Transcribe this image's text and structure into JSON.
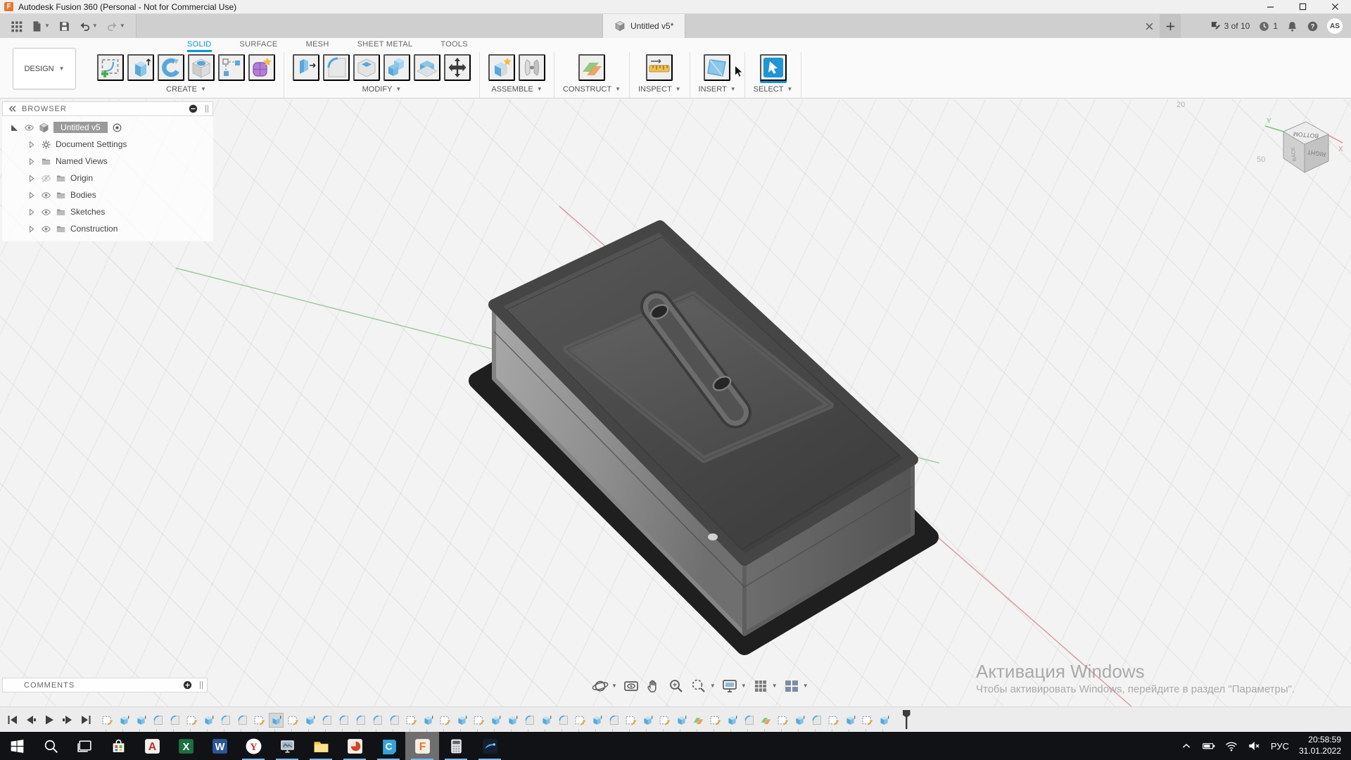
{
  "window": {
    "title": "Autodesk Fusion 360 (Personal - Not for Commercial Use)",
    "controls": [
      {
        "name": "minimize-button",
        "icon": "win-min"
      },
      {
        "name": "maximize-button",
        "icon": "win-max"
      },
      {
        "name": "close-button",
        "icon": "win-close"
      }
    ]
  },
  "quick_access": {
    "buttons": [
      {
        "name": "app-launcher-button",
        "icon": "grid9",
        "caret": false
      },
      {
        "name": "file-menu-button",
        "icon": "file",
        "caret": true
      },
      {
        "name": "save-button",
        "icon": "save",
        "caret": false
      },
      {
        "name": "undo-button",
        "icon": "undo",
        "caret": true
      },
      {
        "name": "redo-button",
        "icon": "redo",
        "caret": true
      }
    ]
  },
  "document_tab": {
    "label": "Untitled v5*"
  },
  "top_right": {
    "extensions_label": "3 of 10",
    "job_count": "1",
    "avatar": "AS"
  },
  "toolbar": {
    "design_label": "DESIGN",
    "tabs": [
      {
        "label": "SOLID",
        "active": true
      },
      {
        "label": "SURFACE",
        "active": false
      },
      {
        "label": "MESH",
        "active": false
      },
      {
        "label": "SHEET METAL",
        "active": false
      },
      {
        "label": "TOOLS",
        "active": false
      }
    ],
    "groups": [
      {
        "label": "CREATE",
        "icons": [
          "create-sketch",
          "extrude",
          "revolve",
          "hole",
          "pattern",
          "create-form"
        ]
      },
      {
        "label": "MODIFY",
        "icons": [
          "press-pull",
          "fillet-tool",
          "shell",
          "combine",
          "split-body",
          "move"
        ]
      },
      {
        "label": "ASSEMBLE",
        "icons": [
          "new-component",
          "joint"
        ]
      },
      {
        "label": "CONSTRUCT",
        "icons": [
          "construct-plane"
        ]
      },
      {
        "label": "INSPECT",
        "icons": [
          "measure"
        ]
      },
      {
        "label": "INSERT",
        "icons": [
          "insert-canvas"
        ]
      },
      {
        "label": "SELECT",
        "icons": [
          "select"
        ]
      }
    ],
    "active_tool": "select"
  },
  "browser": {
    "title": "BROWSER",
    "root": {
      "label": "Untitled v5"
    },
    "items": [
      {
        "label": "Document Settings",
        "icon": "gear",
        "eye": "none"
      },
      {
        "label": "Named Views",
        "icon": "folder",
        "eye": "none"
      },
      {
        "label": "Origin",
        "icon": "folder",
        "eye": "hidden"
      },
      {
        "label": "Bodies",
        "icon": "folder",
        "eye": "visible"
      },
      {
        "label": "Sketches",
        "icon": "folder",
        "eye": "visible"
      },
      {
        "label": "Construction",
        "icon": "folder",
        "eye": "visible"
      }
    ]
  },
  "comments": {
    "title": "COMMENTS"
  },
  "viewport": {
    "grid_labels": [
      "20",
      "50"
    ]
  },
  "viewcube": {
    "face_top": "BOTTOM",
    "face_front": "RIGHT",
    "face_left": "BACK",
    "axis_x": "X",
    "axis_y": "Y"
  },
  "navbar": {
    "buttons": [
      {
        "name": "orbit-button",
        "icon": "orbit",
        "caret": true
      },
      {
        "name": "look-at-button",
        "icon": "look-at",
        "caret": false
      },
      {
        "name": "pan-button",
        "icon": "pan",
        "caret": false
      },
      {
        "name": "zoom-button",
        "icon": "zoom",
        "caret": false
      },
      {
        "name": "fit-button",
        "icon": "fit",
        "caret": true
      },
      {
        "name": "display-settings-button",
        "icon": "display",
        "caret": true
      },
      {
        "name": "grid-settings-button",
        "icon": "grid-set",
        "caret": true
      },
      {
        "name": "viewports-button",
        "icon": "viewports",
        "caret": true
      }
    ]
  },
  "timeline": {
    "controls": [
      {
        "name": "go-to-start-button",
        "icon": "skip-start"
      },
      {
        "name": "step-back-button",
        "icon": "step-back"
      },
      {
        "name": "play-button",
        "icon": "play"
      },
      {
        "name": "step-forward-button",
        "icon": "step-fwd"
      },
      {
        "name": "go-to-end-button",
        "icon": "skip-end"
      }
    ],
    "features": [
      "sketch",
      "extrude",
      "extrude",
      "fillet",
      "fillet",
      "sketch",
      "extrude",
      "fillet",
      "fillet",
      "sketch",
      "extrude",
      "sketch",
      "extrude",
      "fillet",
      "fillet",
      "fillet",
      "fillet",
      "fillet",
      "sketch",
      "extrude",
      "sketch",
      "extrude",
      "sketch",
      "extrude",
      "extrude",
      "fillet",
      "extrude",
      "fillet",
      "sketch",
      "extrude",
      "fillet",
      "sketch",
      "extrude",
      "sketch",
      "extrude",
      "plane",
      "sketch",
      "extrude",
      "fillet",
      "plane",
      "sketch",
      "extrude",
      "fillet",
      "sketch",
      "extrude",
      "sketch",
      "extrude"
    ],
    "selected_index": 10
  },
  "watermark": {
    "line1": "Активация Windows",
    "line2": "Чтобы активировать Windows, перейдите в раздел \"Параметры\"."
  },
  "taskbar": {
    "apps": [
      {
        "name": "start-button",
        "icon": "start",
        "running": false,
        "active": false
      },
      {
        "name": "search-button",
        "icon": "search",
        "running": false,
        "active": false
      },
      {
        "name": "task-view-button",
        "icon": "task-view",
        "running": false,
        "active": false
      },
      {
        "name": "microsoft-store",
        "icon": "store",
        "running": false,
        "active": false
      },
      {
        "name": "autocad",
        "icon": "autocad",
        "running": false,
        "active": false
      },
      {
        "name": "excel",
        "icon": "excel",
        "running": false,
        "active": false
      },
      {
        "name": "word",
        "icon": "word",
        "running": false,
        "active": false
      },
      {
        "name": "yandex-browser",
        "icon": "yandex",
        "running": true,
        "active": false
      },
      {
        "name": "screen-capture-app",
        "icon": "snip",
        "running": true,
        "active": false
      },
      {
        "name": "file-explorer",
        "icon": "explorer",
        "running": true,
        "active": false
      },
      {
        "name": "powerpoint",
        "icon": "powerpoint",
        "running": true,
        "active": false
      },
      {
        "name": "cura",
        "icon": "cura",
        "running": true,
        "active": false
      },
      {
        "name": "fusion-360",
        "icon": "fusion",
        "running": true,
        "active": true
      },
      {
        "name": "calculator",
        "icon": "calculator",
        "running": true,
        "active": false
      },
      {
        "name": "photo-editor",
        "icon": "swirl",
        "running": true,
        "active": false
      }
    ],
    "tray": {
      "icons": [
        {
          "name": "hidden-icons-button",
          "icon": "chevron-up"
        },
        {
          "name": "battery-icon",
          "icon": "battery"
        },
        {
          "name": "wifi-icon",
          "icon": "wifi"
        },
        {
          "name": "volume-muted-icon",
          "icon": "vol-mute"
        }
      ],
      "lang": "РУС",
      "time": "20:58:59",
      "date": "31.01.2022"
    }
  }
}
